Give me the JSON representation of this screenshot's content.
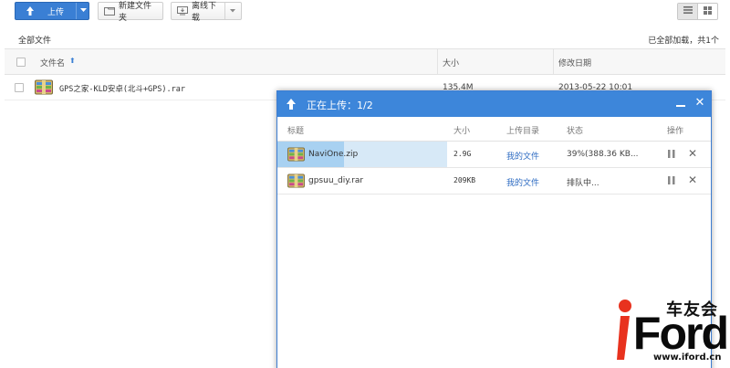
{
  "toolbar": {
    "upload_label": "上传",
    "new_folder_label": "新建文件夹",
    "offline_download_label": "离线下载"
  },
  "breadcrumb": "全部文件",
  "load_info": "已全部加载，共1个",
  "file_table": {
    "headers": {
      "name": "文件名",
      "size": "大小",
      "modified": "修改日期"
    },
    "rows": [
      {
        "name": "GPS之家-KLD安卓(北斗+GPS).rar",
        "size": "135.4M",
        "modified": "2013-05-22 10:01"
      }
    ]
  },
  "upload_dialog": {
    "title": "正在上传：1/2",
    "headers": {
      "title": "标题",
      "size": "大小",
      "dir": "上传目录",
      "status": "状态",
      "action": "操作"
    },
    "rows": [
      {
        "name": "NaviOne.zip",
        "size": "2.9G",
        "dir": "我的文件",
        "status": "39%(388.36 KB...",
        "progress": 39
      },
      {
        "name": "gpsuu_diy.rar",
        "size": "209KB",
        "dir": "我的文件",
        "status": "排队中..."
      }
    ]
  },
  "watermark": {
    "top_text": "车友会",
    "brand_prefix": "i",
    "brand_rest": "Ford",
    "url": "www.iford.cn"
  },
  "colors": {
    "accent": "#3a7fd4",
    "dialog_title": "#3d86da",
    "row_highlight": "#d7e9f7",
    "progress_fill": "#a8d1f1",
    "link": "#2d6bc2",
    "brand_red": "#e8321e"
  },
  "icons": {
    "upload": "upload-arrow-icon",
    "new_folder": "folder-icon",
    "offline": "monitor-download-icon",
    "list_view": "list-view-icon",
    "grid_view": "grid-view-icon",
    "archive": "rar-archive-icon",
    "pause": "pause-icon",
    "close": "close-icon",
    "minimize": "minimize-icon"
  }
}
